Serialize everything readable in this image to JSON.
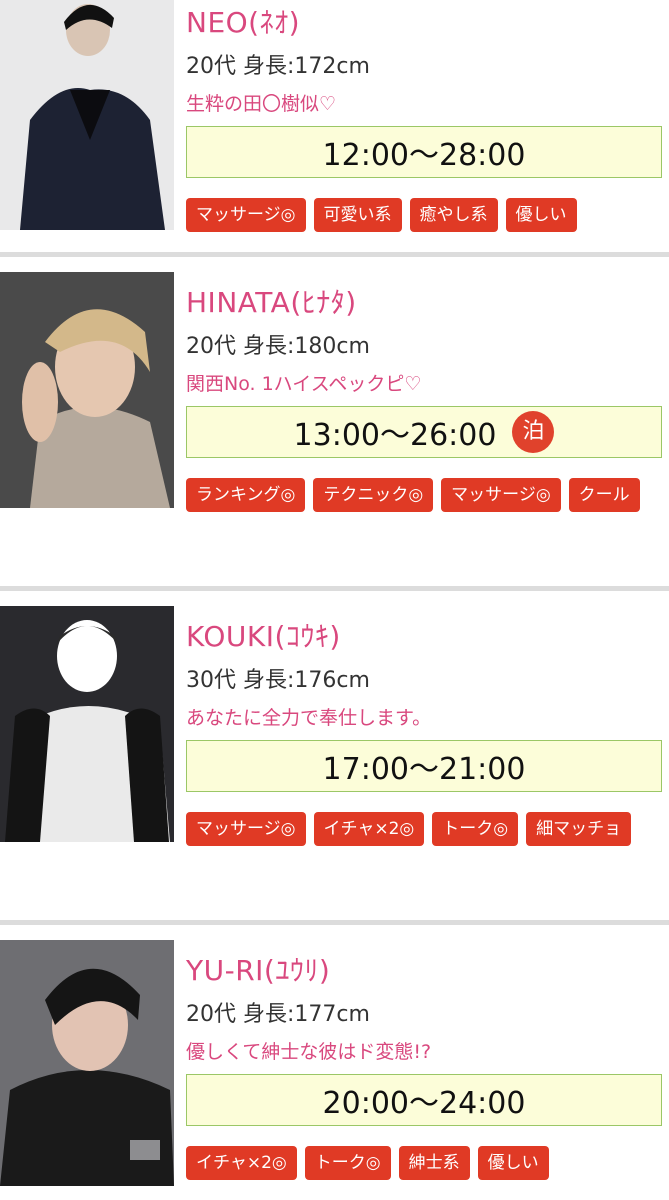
{
  "casts": [
    {
      "name": "NEO(ﾈｵ)",
      "profile": "20代 身長:172cm",
      "catchphrase": "生粋の田〇樹似♡",
      "schedule": "12:00〜28:00",
      "stay_badge": "",
      "tags": [
        "マッサージ◎",
        "可愛い系",
        "癒やし系",
        "優しい"
      ]
    },
    {
      "name": "HINATA(ﾋﾅﾀ)",
      "profile": "20代 身長:180cm",
      "catchphrase": "関西No. 1ハイスペックピ♡",
      "schedule": "13:00〜26:00",
      "stay_badge": "泊",
      "tags": [
        "ランキング◎",
        "テクニック◎",
        "マッサージ◎",
        "クール"
      ]
    },
    {
      "name": "KOUKI(ｺｳｷ)",
      "profile": "30代 身長:176cm",
      "catchphrase": "あなたに全力で奉仕します。",
      "schedule": "17:00〜21:00",
      "stay_badge": "",
      "tags": [
        "マッサージ◎",
        "イチャ×2◎",
        "トーク◎",
        "細マッチョ"
      ]
    },
    {
      "name": "YU-RI(ﾕｳﾘ)",
      "profile": "20代 身長:177cm",
      "catchphrase": "優しくて紳士な彼はド変態!?",
      "schedule": "20:00〜24:00",
      "stay_badge": "",
      "tags": [
        "イチャ×2◎",
        "トーク◎",
        "紳士系",
        "優しい"
      ]
    }
  ],
  "colors": {
    "name_pink": "#d9487e",
    "tag_red": "#e03a25",
    "schedule_bg": "#fcfdd9",
    "schedule_border": "#9bc766"
  }
}
